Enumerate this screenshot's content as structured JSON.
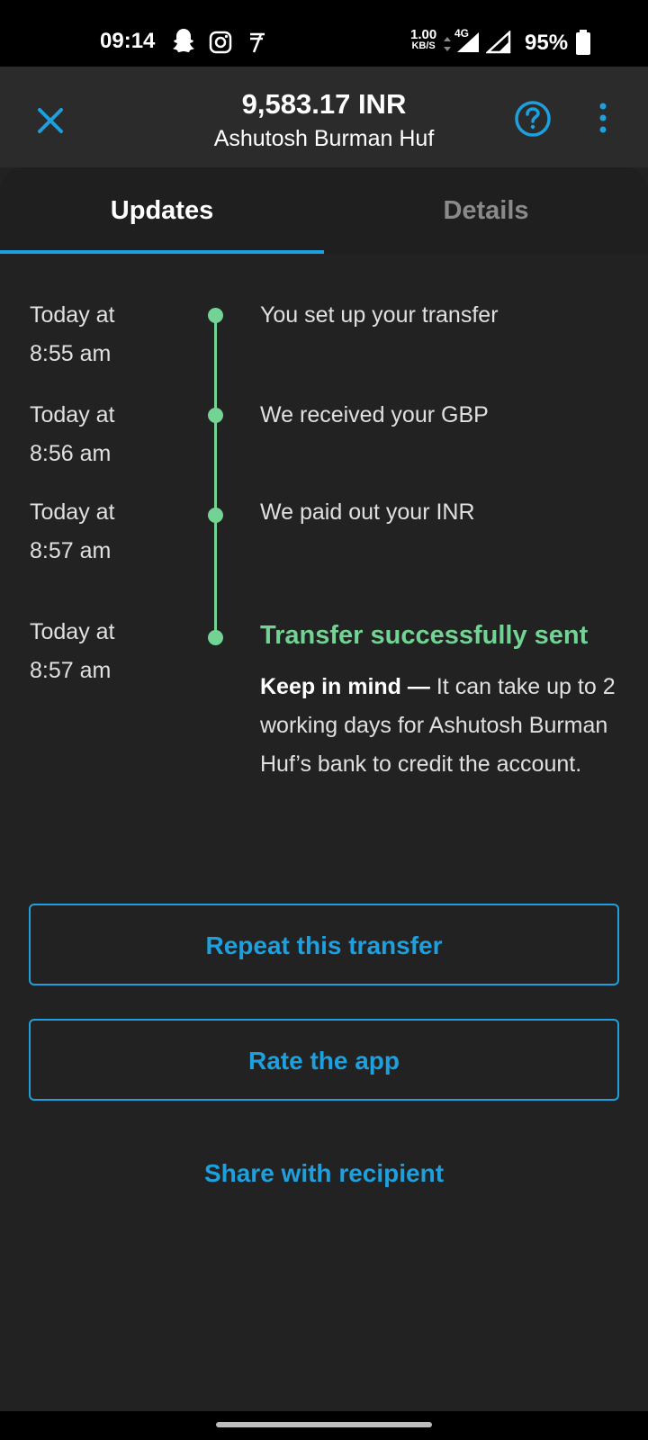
{
  "status_bar": {
    "time": "09:14",
    "icons_left": [
      "snapchat-icon",
      "instagram-icon",
      "tez-icon"
    ],
    "network_speed_value": "1.00",
    "network_speed_unit": "KB/S",
    "network_type": "4G",
    "battery": "95%"
  },
  "header": {
    "amount": "9,583.17 INR",
    "recipient": "Ashutosh Burman Huf",
    "close_icon": "close-icon",
    "help_icon": "question-circle-icon",
    "more_icon": "more-vertical-icon"
  },
  "tabs": [
    {
      "label": "Updates",
      "active": true
    },
    {
      "label": "Details",
      "active": false
    }
  ],
  "timeline": [
    {
      "date": "Today at",
      "time": "8:55 am",
      "text": "You set up your transfer"
    },
    {
      "date": "Today at",
      "time": "8:56 am",
      "text": "We received your GBP"
    },
    {
      "date": "Today at",
      "time": "8:57 am",
      "text": "We paid out your INR"
    },
    {
      "date": "Today at",
      "time": "8:57 am",
      "text": "Transfer successfully sent"
    }
  ],
  "note": {
    "bold": "Keep in mind —",
    "text": " It can take up to 2 working days for Ashutosh Burman Huf’s bank to credit the account."
  },
  "actions": {
    "repeat": "Repeat this transfer",
    "rate": "Rate the app",
    "share": "Share with recipient"
  },
  "colors": {
    "accent": "#1da0dd",
    "success": "#72d394",
    "background": "#222222"
  }
}
